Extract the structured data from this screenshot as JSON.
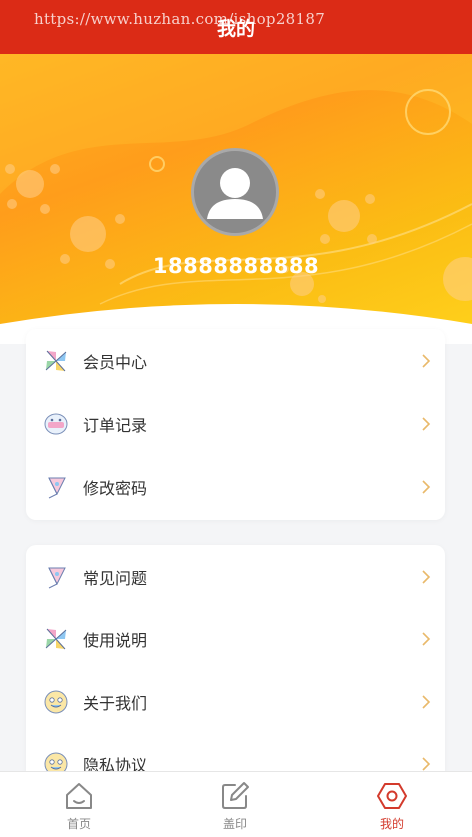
{
  "header": {
    "title": "我的"
  },
  "watermark": "https://www.huzhan.com/ishop28187",
  "profile": {
    "phone": "18888888888"
  },
  "menu_group_1": [
    {
      "label": "会员中心",
      "icon": "pinwheel-icon"
    },
    {
      "label": "订单记录",
      "icon": "cake-icon"
    },
    {
      "label": "修改密码",
      "icon": "kite-icon"
    }
  ],
  "menu_group_2": [
    {
      "label": "常见问题",
      "icon": "kite-icon"
    },
    {
      "label": "使用说明",
      "icon": "pinwheel-icon"
    },
    {
      "label": "关于我们",
      "icon": "face-icon"
    },
    {
      "label": "隐私协议",
      "icon": "face-icon"
    }
  ],
  "tabbar": {
    "tabs": [
      {
        "label": "首页",
        "icon": "home-icon",
        "active": false
      },
      {
        "label": "盖印",
        "icon": "edit-icon",
        "active": false
      },
      {
        "label": "我的",
        "icon": "profile-hexagon-icon",
        "active": true
      }
    ]
  },
  "colors": {
    "header": "#db2b16",
    "hero_start": "#ff9d1b",
    "hero_end": "#ffd21c",
    "active_tab": "#d33a2c",
    "arrow": "#e9b96a"
  }
}
